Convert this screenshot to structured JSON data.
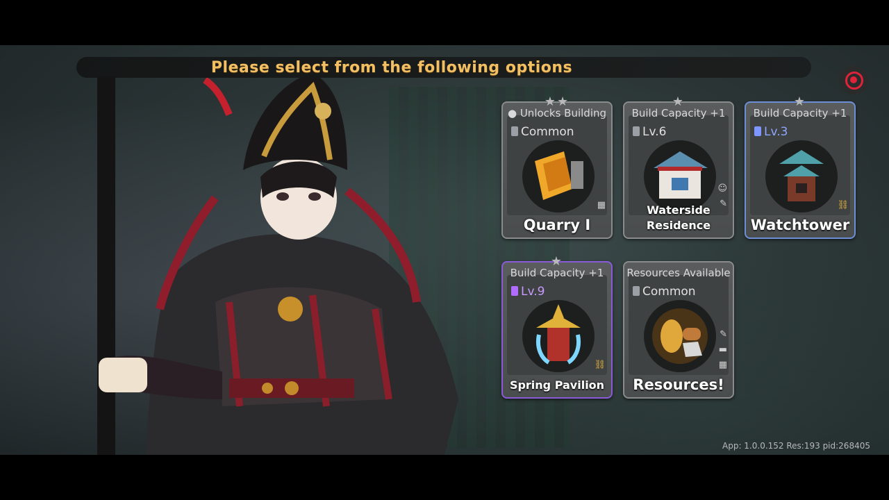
{
  "banner": {
    "text": "Please select from the following options"
  },
  "record_button": {
    "icon": "record-icon",
    "color": "#e0233a"
  },
  "options": [
    {
      "header": "Unlocks Building",
      "tag": "Common",
      "title": "Quarry Ⅰ",
      "stars": "★★",
      "side_icons": [
        "stone-icon"
      ]
    },
    {
      "header": "Build Capacity +1",
      "tag": "Lv.6",
      "title": "Waterside Residence",
      "stars": "★",
      "side_icons": [
        "worker-icon",
        "brush-icon"
      ]
    },
    {
      "header": "Build Capacity +1",
      "tag": "Lv.3",
      "title": "Watchtower",
      "stars": "★",
      "side_icons": [
        "link-icon"
      ]
    },
    {
      "header": "Build Capacity +1",
      "tag": "Lv.9",
      "title": "Spring Pavilion",
      "stars": "★",
      "side_icons": [
        "link-icon"
      ]
    },
    {
      "header": "Resources Available",
      "tag": "Common",
      "title": "Resources!",
      "stars": "",
      "side_icons": [
        "brush-icon",
        "wood-icon",
        "stone-icon"
      ]
    }
  ],
  "build_info": "App: 1.0.0.152 Res:193 pid:268405"
}
